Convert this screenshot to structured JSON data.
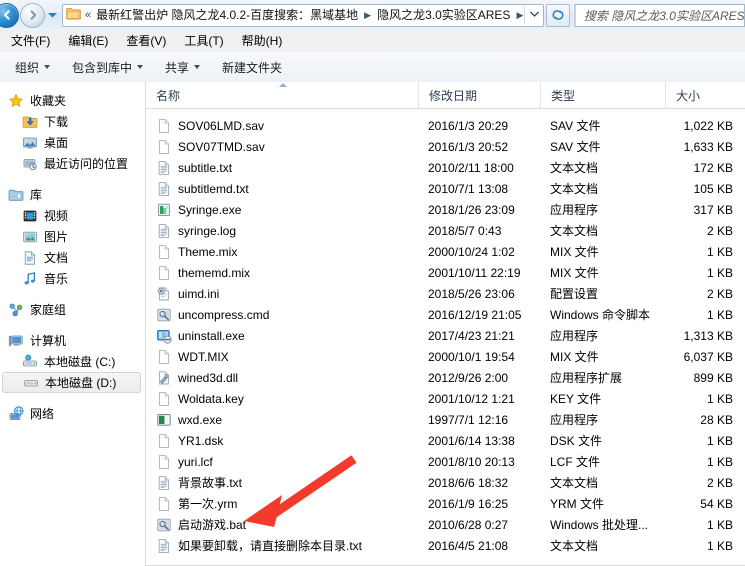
{
  "window": {
    "title": "隐风之龙3.0实验区ARES"
  },
  "addressbar": {
    "back_title": "后退",
    "forward_title": "前进",
    "history_title": "最近浏览的页面",
    "breadcrumb_overflow": "«",
    "crumbs": [
      "最新红警出炉 隐风之龙4.0.2-百度搜索：黑域基地",
      "隐风之龙3.0实验区ARES"
    ],
    "separator": "▶",
    "dropdown_icon": "chevron-down-icon",
    "refresh_icon": "refresh-icon",
    "folder_icon": "folder-icon"
  },
  "search": {
    "placeholder": "搜索 隐风之龙3.0实验区ARES",
    "icon": "search-icon"
  },
  "menubar": {
    "items": [
      {
        "label": "文件(F)"
      },
      {
        "label": "编辑(E)"
      },
      {
        "label": "查看(V)"
      },
      {
        "label": "工具(T)"
      },
      {
        "label": "帮助(H)"
      }
    ]
  },
  "toolbar": {
    "items": [
      {
        "label": "组织",
        "caret": true
      },
      {
        "label": "包含到库中",
        "caret": true
      },
      {
        "label": "共享",
        "caret": true
      },
      {
        "label": "新建文件夹",
        "caret": false
      }
    ]
  },
  "sidebar": {
    "groups": [
      {
        "header": {
          "label": "收藏夹",
          "icon": "star-icon"
        },
        "items": [
          {
            "label": "下载",
            "icon": "downloads-icon",
            "selected": false
          },
          {
            "label": "桌面",
            "icon": "desktop-icon",
            "selected": false
          },
          {
            "label": "最近访问的位置",
            "icon": "recent-places-icon",
            "selected": false
          }
        ]
      },
      {
        "header": {
          "label": "库",
          "icon": "library-icon"
        },
        "items": [
          {
            "label": "视频",
            "icon": "video-icon",
            "selected": false
          },
          {
            "label": "图片",
            "icon": "pictures-icon",
            "selected": false
          },
          {
            "label": "文档",
            "icon": "documents-icon",
            "selected": false
          },
          {
            "label": "音乐",
            "icon": "music-icon",
            "selected": false
          }
        ]
      },
      {
        "header": {
          "label": "家庭组",
          "icon": "homegroup-icon"
        },
        "items": []
      },
      {
        "header": {
          "label": "计算机",
          "icon": "computer-icon"
        },
        "items": [
          {
            "label": "本地磁盘 (C:)",
            "icon": "system-drive-icon",
            "selected": false
          },
          {
            "label": "本地磁盘 (D:)",
            "icon": "drive-icon",
            "selected": true
          }
        ]
      },
      {
        "header": {
          "label": "网络",
          "icon": "network-icon"
        },
        "items": []
      }
    ]
  },
  "filelist": {
    "columns": [
      {
        "label": "名称",
        "sorted": true
      },
      {
        "label": "修改日期",
        "sorted": false
      },
      {
        "label": "类型",
        "sorted": false
      },
      {
        "label": "大小",
        "sorted": false
      }
    ],
    "rows": [
      {
        "name": "SOV06LMD.sav",
        "date": "2016/1/3 20:29",
        "type": "SAV 文件",
        "size": "1,022 KB",
        "icon": "generic-file-icon"
      },
      {
        "name": "SOV07TMD.sav",
        "date": "2016/1/3 20:52",
        "type": "SAV 文件",
        "size": "1,633 KB",
        "icon": "generic-file-icon"
      },
      {
        "name": "subtitle.txt",
        "date": "2010/2/11 18:00",
        "type": "文本文档",
        "size": "172 KB",
        "icon": "text-file-icon"
      },
      {
        "name": "subtitlemd.txt",
        "date": "2010/7/1 13:08",
        "type": "文本文档",
        "size": "105 KB",
        "icon": "text-file-icon"
      },
      {
        "name": "Syringe.exe",
        "date": "2018/1/26 23:09",
        "type": "应用程序",
        "size": "317 KB",
        "icon": "syringe-app-icon"
      },
      {
        "name": "syringe.log",
        "date": "2018/5/7 0:43",
        "type": "文本文档",
        "size": "2 KB",
        "icon": "text-file-icon"
      },
      {
        "name": "Theme.mix",
        "date": "2000/10/24 1:02",
        "type": "MIX 文件",
        "size": "1 KB",
        "icon": "generic-file-icon"
      },
      {
        "name": "thememd.mix",
        "date": "2001/10/11 22:19",
        "type": "MIX 文件",
        "size": "1 KB",
        "icon": "generic-file-icon"
      },
      {
        "name": "uimd.ini",
        "date": "2018/5/26 23:06",
        "type": "配置设置",
        "size": "2 KB",
        "icon": "ini-file-icon"
      },
      {
        "name": "uncompress.cmd",
        "date": "2016/12/19 21:05",
        "type": "Windows 命令脚本",
        "size": "1 KB",
        "icon": "script-file-icon"
      },
      {
        "name": "uninstall.exe",
        "date": "2017/4/23 21:21",
        "type": "应用程序",
        "size": "1,313 KB",
        "icon": "uninstall-app-icon"
      },
      {
        "name": "WDT.MIX",
        "date": "2000/10/1 19:54",
        "type": "MIX 文件",
        "size": "6,037 KB",
        "icon": "generic-file-icon"
      },
      {
        "name": "wined3d.dll",
        "date": "2012/9/26 2:00",
        "type": "应用程序扩展",
        "size": "899 KB",
        "icon": "dll-file-icon"
      },
      {
        "name": "Woldata.key",
        "date": "2001/10/12 1:21",
        "type": "KEY 文件",
        "size": "1 KB",
        "icon": "generic-file-icon"
      },
      {
        "name": "wxd.exe",
        "date": "1997/7/1 12:16",
        "type": "应用程序",
        "size": "28 KB",
        "icon": "wxd-app-icon"
      },
      {
        "name": "YR1.dsk",
        "date": "2001/6/14 13:38",
        "type": "DSK 文件",
        "size": "1 KB",
        "icon": "generic-file-icon"
      },
      {
        "name": "yuri.lcf",
        "date": "2001/8/10 20:13",
        "type": "LCF 文件",
        "size": "1 KB",
        "icon": "generic-file-icon"
      },
      {
        "name": "背景故事.txt",
        "date": "2018/6/6 18:32",
        "type": "文本文档",
        "size": "2 KB",
        "icon": "text-file-icon"
      },
      {
        "name": "第一次.yrm",
        "date": "2016/1/9 16:25",
        "type": "YRM 文件",
        "size": "54 KB",
        "icon": "generic-file-icon"
      },
      {
        "name": "启动游戏.bat",
        "date": "2010/6/28 0:27",
        "type": "Windows 批处理...",
        "size": "1 KB",
        "icon": "script-file-icon"
      },
      {
        "name": "如果要卸载，请直接删除本目录.txt",
        "date": "2016/4/5 21:08",
        "type": "文本文档",
        "size": "1 KB",
        "icon": "text-file-icon"
      }
    ]
  },
  "annotation": {
    "arrow_color": "#f23b2b",
    "arrow_target": "启动游戏.bat"
  }
}
